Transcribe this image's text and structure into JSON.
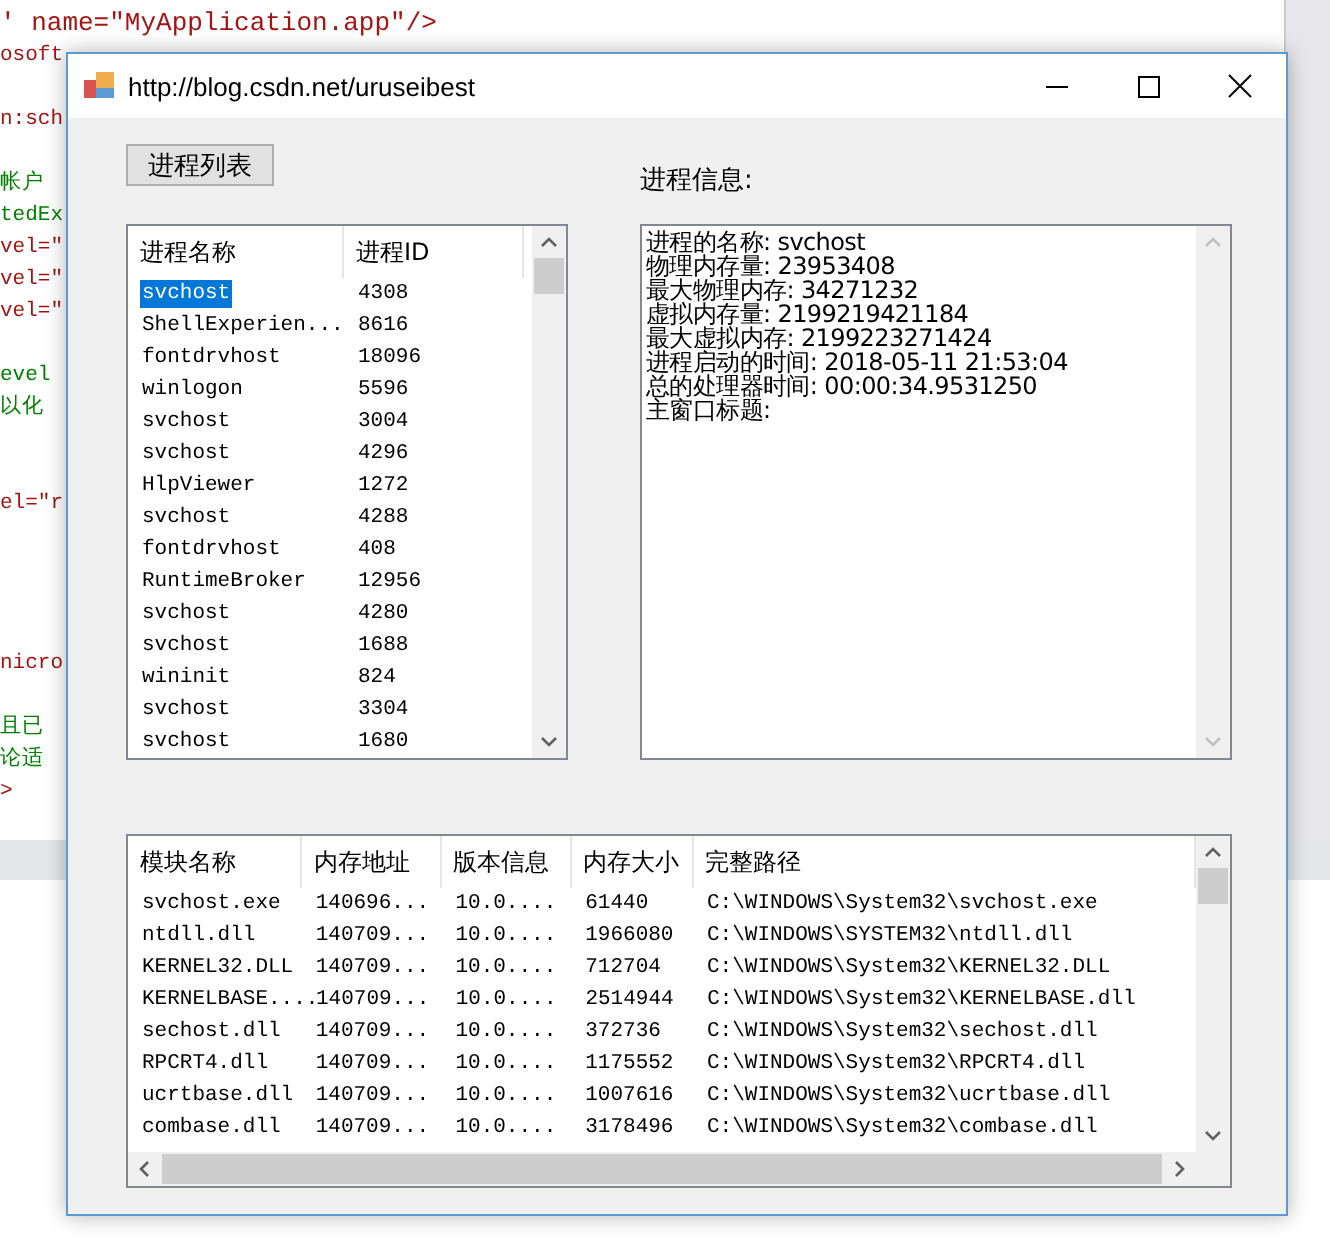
{
  "background_editor": {
    "lines": [
      {
        "text": "' name=\"MyApplication.app\"/>",
        "kind": "code"
      },
      {
        "text": "osoft",
        "kind": "code"
      },
      {
        "kind": "blank"
      },
      {
        "text": "n:sch",
        "kind": "code"
      },
      {
        "kind": "blank"
      },
      {
        "text": "帐户",
        "kind": "comment"
      },
      {
        "text": "tedEx",
        "kind": "comment"
      },
      {
        "text": "vel=\"",
        "kind": "code"
      },
      {
        "text": "vel=\"",
        "kind": "code"
      },
      {
        "text": "vel=\"",
        "kind": "code"
      },
      {
        "kind": "blank"
      },
      {
        "text": "evel",
        "kind": "comment"
      },
      {
        "text": "以化",
        "kind": "comment"
      },
      {
        "kind": "blank"
      },
      {
        "kind": "blank"
      },
      {
        "text": "el=\"r",
        "kind": "code"
      },
      {
        "kind": "blank"
      },
      {
        "kind": "blank"
      },
      {
        "kind": "blank"
      },
      {
        "kind": "blank"
      },
      {
        "text": "nicro",
        "kind": "code"
      },
      {
        "kind": "blank"
      },
      {
        "text": "且已",
        "kind": "comment"
      },
      {
        "text": "论适",
        "kind": "comment"
      },
      {
        "text": ">",
        "kind": "code"
      }
    ]
  },
  "window": {
    "title": "http://blog.csdn.net/uruseibest"
  },
  "process_button": "进程列表",
  "info_label": "进程信息:",
  "process_list": {
    "columns": [
      "进程名称",
      "进程ID"
    ],
    "rows": [
      {
        "name": "svchost",
        "id": "4308",
        "selected": true
      },
      {
        "name": "ShellExperien...",
        "id": "8616",
        "selected": false
      },
      {
        "name": "fontdrvhost",
        "id": "18096",
        "selected": false
      },
      {
        "name": "winlogon",
        "id": "5596",
        "selected": false
      },
      {
        "name": "svchost",
        "id": "3004",
        "selected": false
      },
      {
        "name": "svchost",
        "id": "4296",
        "selected": false
      },
      {
        "name": "HlpViewer",
        "id": "1272",
        "selected": false
      },
      {
        "name": "svchost",
        "id": "4288",
        "selected": false
      },
      {
        "name": "fontdrvhost",
        "id": "408",
        "selected": false
      },
      {
        "name": "RuntimeBroker",
        "id": "12956",
        "selected": false
      },
      {
        "name": "svchost",
        "id": "4280",
        "selected": false
      },
      {
        "name": "svchost",
        "id": "1688",
        "selected": false
      },
      {
        "name": "wininit",
        "id": "824",
        "selected": false
      },
      {
        "name": "svchost",
        "id": "3304",
        "selected": false
      },
      {
        "name": "svchost",
        "id": "1680",
        "selected": false
      }
    ]
  },
  "info_text": {
    "lines": [
      "进程的名称: svchost",
      "物理内存量: 23953408",
      "最大物理内存: 34271232",
      "虚拟内存量: 2199219421184",
      "最大虚拟内存: 2199223271424",
      "进程启动的时间: 2018-05-11 21:53:04",
      "总的处理器时间: 00:00:34.9531250",
      "主窗口标题:"
    ]
  },
  "module_list": {
    "columns": [
      "模块名称",
      "内存地址",
      "版本信息",
      "内存大小",
      "完整路径"
    ],
    "rows": [
      [
        "svchost.exe",
        "140696...",
        "10.0....",
        "61440",
        "C:\\WINDOWS\\System32\\svchost.exe"
      ],
      [
        "ntdll.dll",
        "140709...",
        "10.0....",
        "1966080",
        "C:\\WINDOWS\\SYSTEM32\\ntdll.dll"
      ],
      [
        "KERNEL32.DLL",
        "140709...",
        "10.0....",
        "712704",
        "C:\\WINDOWS\\System32\\KERNEL32.DLL"
      ],
      [
        "KERNELBASE....",
        "140709...",
        "10.0....",
        "2514944",
        "C:\\WINDOWS\\System32\\KERNELBASE.dll"
      ],
      [
        "sechost.dll",
        "140709...",
        "10.0....",
        "372736",
        "C:\\WINDOWS\\System32\\sechost.dll"
      ],
      [
        "RPCRT4.dll",
        "140709...",
        "10.0....",
        "1175552",
        "C:\\WINDOWS\\System32\\RPCRT4.dll"
      ],
      [
        "ucrtbase.dll",
        "140709...",
        "10.0....",
        "1007616",
        "C:\\WINDOWS\\System32\\ucrtbase.dll"
      ],
      [
        "combase.dll",
        "140709...",
        "10.0....",
        "3178496",
        "C:\\WINDOWS\\System32\\combase.dll"
      ]
    ]
  }
}
